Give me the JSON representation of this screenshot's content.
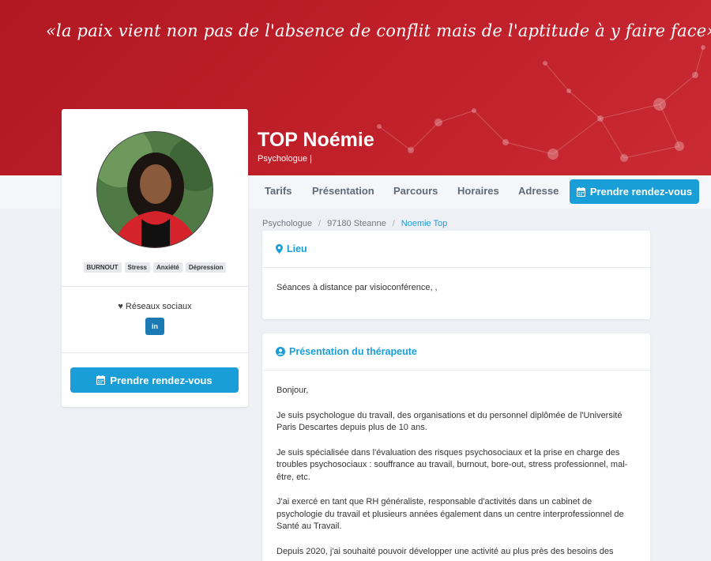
{
  "banner": {
    "quote": "«la paix vient non pas de l'absence de conflit mais de l'aptitude à y faire face»",
    "name": "TOP Noémie",
    "role": "Psychologue |"
  },
  "nav": {
    "items": [
      "Tarifs",
      "Présentation",
      "Parcours",
      "Horaires",
      "Adresse"
    ],
    "cta": "Prendre rendez-vous"
  },
  "profile": {
    "tags": [
      "BURNOUT",
      "Stress",
      "Anxiété",
      "Dépression"
    ],
    "social_title": "Réseaux sociaux",
    "linkedin": "in",
    "cta": "Prendre rendez-vous"
  },
  "breadcrumb": [
    "Psychologue",
    "97180 Steanne",
    "Noemie Top"
  ],
  "lieu": {
    "title": "Lieu",
    "text": "Séances à distance par visioconférence, ,"
  },
  "presentation": {
    "title": "Présentation du thérapeute",
    "paragraphs": [
      "Bonjour,",
      "Je suis psychologue du travail, des organisations et du personnel diplômée de l'Université Paris Descartes depuis plus de 10 ans.",
      "Je suis spécialisée dans l'évaluation des risques psychosociaux et la prise en charge des troubles psychosociaux : souffrance au travail, burnout, bore-out, stress professionnel, mal-être, etc.",
      "J'ai exercé en tant que RH généraliste, responsable d'activités dans un cabinet de psychologie du travail et plusieurs années également dans un centre interprofessionnel de Santé au Travail.",
      "Depuis 2020, j'ai souhaité pouvoir développer une activité au plus près des besoins des"
    ]
  },
  "colors": {
    "banner": "#c0202a",
    "accent": "#1a9ed8",
    "linkedin": "#1b7ab4"
  },
  "icons": {
    "calendar": "calendar-icon",
    "heart": "heart-icon",
    "pin": "map-pin-icon",
    "user": "user-circle-icon"
  }
}
